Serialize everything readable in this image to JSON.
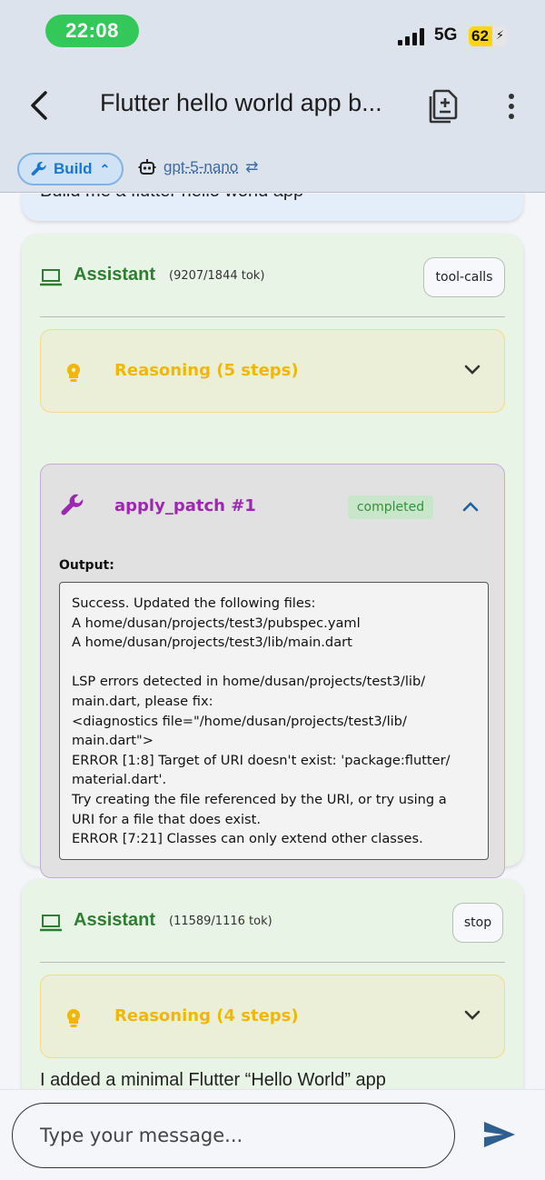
{
  "status_bar": {
    "time": "22:08",
    "network": "5G",
    "battery": "62",
    "battery_level_percent": 62
  },
  "app_bar": {
    "title": "Flutter hello world app b..."
  },
  "mode_bar": {
    "mode_label": "Build",
    "model": "gpt-5-nano"
  },
  "messages": {
    "user_text": "Build me a flutter hello world app",
    "assistant1": {
      "role": "Assistant",
      "tokens": "(9207/1844 tok)",
      "finish": "tool-calls",
      "reasoning": "Reasoning (5 steps)",
      "tool": {
        "name": "apply_patch #1",
        "status": "completed",
        "output_label": "Output:",
        "output": "Success. Updated the following files:\nA home/dusan/projects/test3/pubspec.yaml\nA home/dusan/projects/test3/lib/main.dart\n\nLSP errors detected in home/dusan/projects/test3/lib/\nmain.dart, please fix:\n<diagnostics file=\"/home/dusan/projects/test3/lib/\nmain.dart\">\nERROR [1:8] Target of URI doesn't exist: 'package:flutter/\nmaterial.dart'.\nTry creating the file referenced by the URI, or try using a\nURI for a file that does exist.\nERROR [7:21] Classes can only extend other classes."
      }
    },
    "assistant2": {
      "role": "Assistant",
      "tokens": "(11589/1116 tok)",
      "finish": "stop",
      "reasoning": "Reasoning (4 steps)",
      "text": "I added a minimal Flutter “Hello World” app"
    }
  },
  "composer": {
    "placeholder": "Type your message..."
  },
  "colors": {
    "accent_green": "#2e7d32",
    "tool_purple": "#9c27b0",
    "reasoning_yellow": "#f2b705",
    "build_blue": "#1976d2",
    "status_green": "#34c759"
  },
  "icons": [
    "back-icon",
    "document-add-icon",
    "more-vert-icon",
    "wrench-icon",
    "robot-icon",
    "laptop-icon",
    "lightbulb-icon",
    "chevron-down-icon",
    "chevron-up-icon",
    "send-icon"
  ]
}
